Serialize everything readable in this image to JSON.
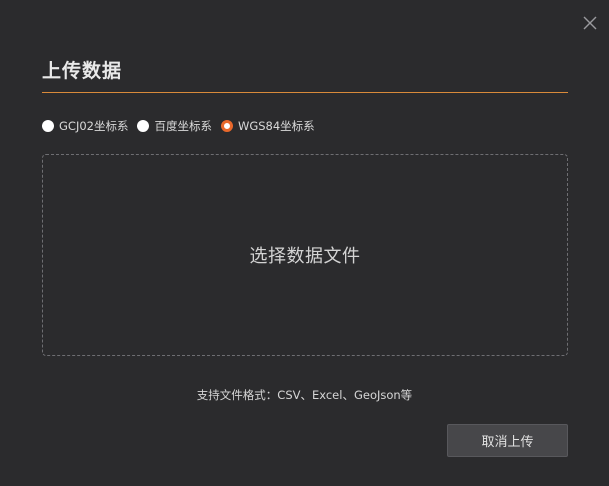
{
  "dialog": {
    "title": "上传数据",
    "close_icon": "close-icon",
    "accent_color": "#e8682b"
  },
  "coordinate_options": [
    {
      "label": "GCJ02坐标系",
      "selected": false
    },
    {
      "label": "百度坐标系",
      "selected": false
    },
    {
      "label": "WGS84坐标系",
      "selected": true
    }
  ],
  "drop_zone": {
    "label": "选择数据文件"
  },
  "format_hint": "支持文件格式：CSV、Excel、GeoJson等",
  "footer": {
    "cancel_label": "取消上传"
  }
}
